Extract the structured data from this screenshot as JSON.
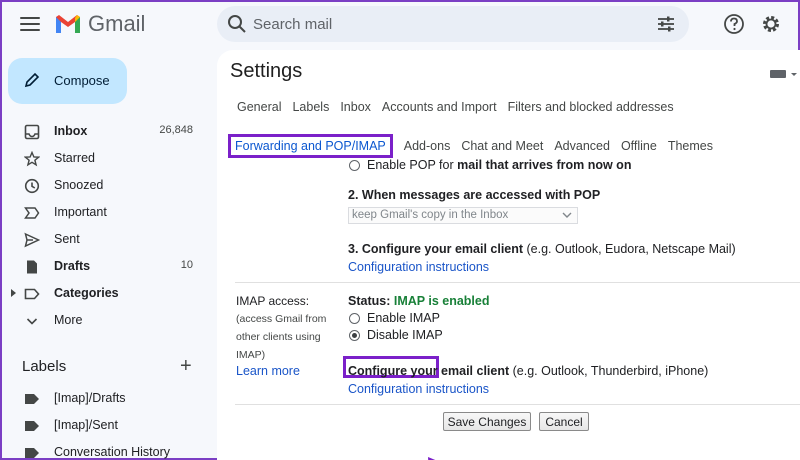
{
  "app": {
    "name": "Gmail"
  },
  "search": {
    "placeholder": "Search mail"
  },
  "compose": {
    "label": "Compose"
  },
  "nav": [
    {
      "label": "Inbox",
      "count": "26,848",
      "bold": true,
      "icon": "inbox-icon"
    },
    {
      "label": "Starred",
      "count": "",
      "bold": false,
      "icon": "star-icon"
    },
    {
      "label": "Snoozed",
      "count": "",
      "bold": false,
      "icon": "clock-icon"
    },
    {
      "label": "Important",
      "count": "",
      "bold": false,
      "icon": "important-icon"
    },
    {
      "label": "Sent",
      "count": "",
      "bold": false,
      "icon": "send-icon"
    },
    {
      "label": "Drafts",
      "count": "10",
      "bold": true,
      "icon": "draft-icon"
    },
    {
      "label": "Categories",
      "count": "",
      "bold": true,
      "icon": "label-icon"
    },
    {
      "label": "More",
      "count": "",
      "bold": false,
      "icon": "chevron-down-icon"
    }
  ],
  "labels": {
    "heading": "Labels",
    "items": [
      "[Imap]/Drafts",
      "[Imap]/Sent",
      "Conversation History"
    ]
  },
  "settings": {
    "title": "Settings",
    "tabs_row1": [
      "General",
      "Labels",
      "Inbox",
      "Accounts and Import",
      "Filters and blocked addresses"
    ],
    "tabs_row2": [
      "Forwarding and POP/IMAP",
      "Add-ons",
      "Chat and Meet",
      "Advanced",
      "Offline",
      "Themes"
    ],
    "active_tab": "Forwarding and POP/IMAP"
  },
  "pop": {
    "enable_option_prefix": "Enable POP for ",
    "enable_option_bold": "mail that arrives from now on",
    "step2_title": "2. When messages are accessed with POP",
    "step2_select": "keep Gmail's copy in the Inbox",
    "step3_title": "3. Configure your email client",
    "step3_hint": " (e.g. Outlook, Eudora, Netscape Mail)",
    "config_link": "Configuration instructions"
  },
  "imap": {
    "label": "IMAP access:",
    "desc1": "(access Gmail from",
    "desc2": "other clients using",
    "desc3": "IMAP)",
    "learn_more": "Learn more",
    "status_prefix": "Status: ",
    "status_value": "IMAP is enabled",
    "status_color": "#188038",
    "enable": "Enable IMAP",
    "disable": "Disable IMAP",
    "selected": "Disable IMAP",
    "client_title": "Configure your email client",
    "client_hint": " (e.g. Outlook, Thunderbird, iPhone)",
    "config_link": "Configuration instructions"
  },
  "actions": {
    "save": "Save Changes",
    "cancel": "Cancel"
  },
  "colors": {
    "highlight": "#7b20c9",
    "link": "#1a55c8",
    "compose_bg": "#c2e7ff"
  }
}
